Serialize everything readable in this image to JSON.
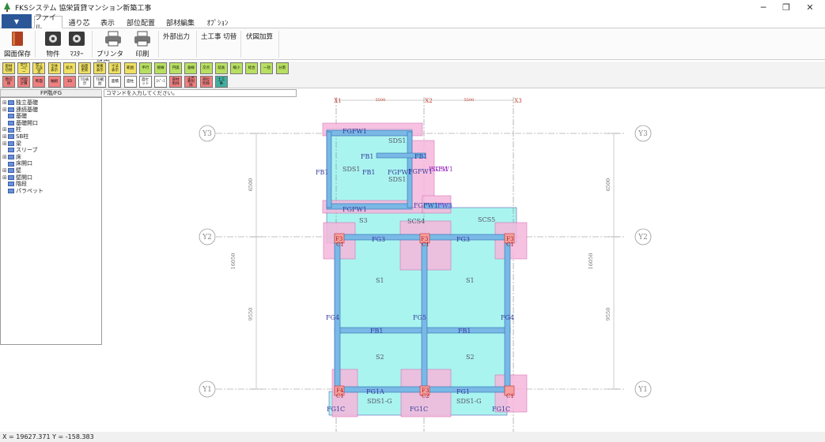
{
  "window": {
    "title": "FKSシステム 協栄賃貸マンション新築工事"
  },
  "menu_tabs": [
    "ファイル",
    "通り芯",
    "表示",
    "部位配置",
    "部材編集",
    "ｵﾌﾟｼｮﾝ"
  ],
  "ribbon": {
    "save": "図面保存",
    "property": "物件",
    "master": "ﾏｽﾀｰ",
    "printer_settings": "プリンタ設定",
    "print": "印刷",
    "export": "外部出力",
    "earthwork": "土工事 切替",
    "takeoff": "伏図加算"
  },
  "toolbar1": [
    {
      "label": "部材切替",
      "color": "#f0e060"
    },
    {
      "label": "部材コピー",
      "color": "#f0e060"
    },
    {
      "label": "通り芯設定",
      "color": "#f0e060"
    },
    {
      "label": "全体表示",
      "color": "#f0e060"
    },
    {
      "label": "拡大",
      "color": "#f0e060"
    },
    {
      "label": "画面更新",
      "color": "#f0e060"
    },
    {
      "label": "要素表示",
      "color": "#f0e060"
    },
    {
      "label": "寸法表示",
      "color": "#f0e060"
    },
    {
      "label": "範囲",
      "color": "#f0e060"
    },
    {
      "label": "平行",
      "color": "#b8e060"
    },
    {
      "label": "接線",
      "color": "#b8e060"
    },
    {
      "label": "円弧",
      "color": "#b8e060"
    },
    {
      "label": "垂線",
      "color": "#b8e060"
    },
    {
      "label": "交点",
      "color": "#b8e060"
    },
    {
      "label": "延長",
      "color": "#b8e060"
    },
    {
      "label": "縮小",
      "color": "#b8e060"
    },
    {
      "label": "結合",
      "color": "#b8e060"
    },
    {
      "label": "一括",
      "color": "#b8e060"
    },
    {
      "label": "分割",
      "color": "#b8e060"
    }
  ],
  "toolbar2": [
    {
      "label": "階切替",
      "color": "#f08080"
    },
    {
      "label": "伏図計算",
      "color": "#f08080"
    },
    {
      "label": "断面",
      "color": "#f08080"
    },
    {
      "label": "軸組",
      "color": "#f08080"
    },
    {
      "label": "3D",
      "color": "#f08080"
    },
    {
      "label": "TD表示",
      "color": "#ffffff"
    },
    {
      "label": "TD範囲",
      "color": "#ffffff"
    },
    {
      "label": "面積",
      "color": "#ffffff"
    },
    {
      "label": "面柱",
      "color": "#ffffff"
    },
    {
      "label": "面セット",
      "color": "#ffffff"
    },
    {
      "label": "ｽﾍﾟｰｽ",
      "color": "#ffffff"
    },
    {
      "label": "部材削除",
      "color": "#f08080"
    },
    {
      "label": "全要素削除",
      "color": "#f08080"
    },
    {
      "label": "部位削除",
      "color": "#f08080"
    },
    {
      "label": "土工事",
      "color": "#40b0a0"
    }
  ],
  "side_tab": "FP階/FG",
  "command_prompt": "コマンドを入力してください。",
  "tree": [
    {
      "label": "独立基礎",
      "expander": "⊞"
    },
    {
      "label": "連続基礎",
      "expander": "⊞"
    },
    {
      "label": "基礎",
      "expander": ""
    },
    {
      "label": "基礎開口",
      "expander": ""
    },
    {
      "label": "柱",
      "expander": "⊞"
    },
    {
      "label": "SB柱",
      "expander": "⊞"
    },
    {
      "label": "梁",
      "expander": "⊞"
    },
    {
      "label": "スリーブ",
      "expander": ""
    },
    {
      "label": "床",
      "expander": "⊞"
    },
    {
      "label": "床開口",
      "expander": ""
    },
    {
      "label": "壁",
      "expander": "⊞"
    },
    {
      "label": "壁開口",
      "expander": "⊞"
    },
    {
      "label": "階段",
      "expander": ""
    },
    {
      "label": "パラペット",
      "expander": ""
    }
  ],
  "drawing": {
    "grid_x": [
      "X1",
      "X2",
      "X3"
    ],
    "span_x": [
      "5500",
      "5500"
    ],
    "grid_y": [
      "Y3",
      "Y2",
      "Y1"
    ],
    "span_y_upper": "6500",
    "span_y_lower": "9550",
    "span_y_total": "16050",
    "labels": {
      "FGFW1": "FGFW1",
      "FGFW1b": "FGFW1",
      "FGFW1c": "FGFW1",
      "FGFW1_mid": "FGFW1",
      "FGFW1_mid2": "FGFW1",
      "FGFW1_mid3": "FGFW1",
      "SDS1_a": "SDS1",
      "SDS1_b": "SDS1",
      "SDS1_c": "SDS1",
      "SCS1": "SCS1",
      "SCS4": "SCS4",
      "SCS5": "SCS5",
      "FB1_a": "FB1",
      "FB1_b": "FB1",
      "FB1_c": "FB1",
      "FB1_d": "FB1",
      "FB1_e": "FB1",
      "FB1_f": "FB1",
      "FW3": "FW3",
      "S3": "S3",
      "F3a": "F3",
      "F3b": "F3",
      "F3c": "F3",
      "C1a": "C1",
      "C1b": "C1",
      "C1c": "C1",
      "F4a": "F4",
      "F3d": "F3",
      "C2": "C2",
      "C1d": "C1",
      "C1e": "C1",
      "FG3a": "FG3",
      "FG3b": "FG3",
      "S1a": "S1",
      "S1b": "S1",
      "FG4a": "FG4",
      "FG5": "FG5",
      "FG4b": "FG4",
      "S2a": "S2",
      "S2b": "S2",
      "FG1A": "FG1A",
      "FG1": "FG1",
      "SDS1G_a": "SDS1-G",
      "SDS1G_b": "SDS1-G",
      "FG1Ca": "FG1C",
      "FG1Cb": "FG1C",
      "FG1Cc": "FG1C"
    }
  },
  "status": {
    "coords": "X = 19627.371 Y = -158.383"
  },
  "colors": {
    "accent": "#2b5797",
    "slab": "#aaf4f0",
    "beam": "#7ab8e6",
    "footing": "#f6b8dc",
    "grid": "#888888",
    "gridlabel": "#c0392b"
  }
}
